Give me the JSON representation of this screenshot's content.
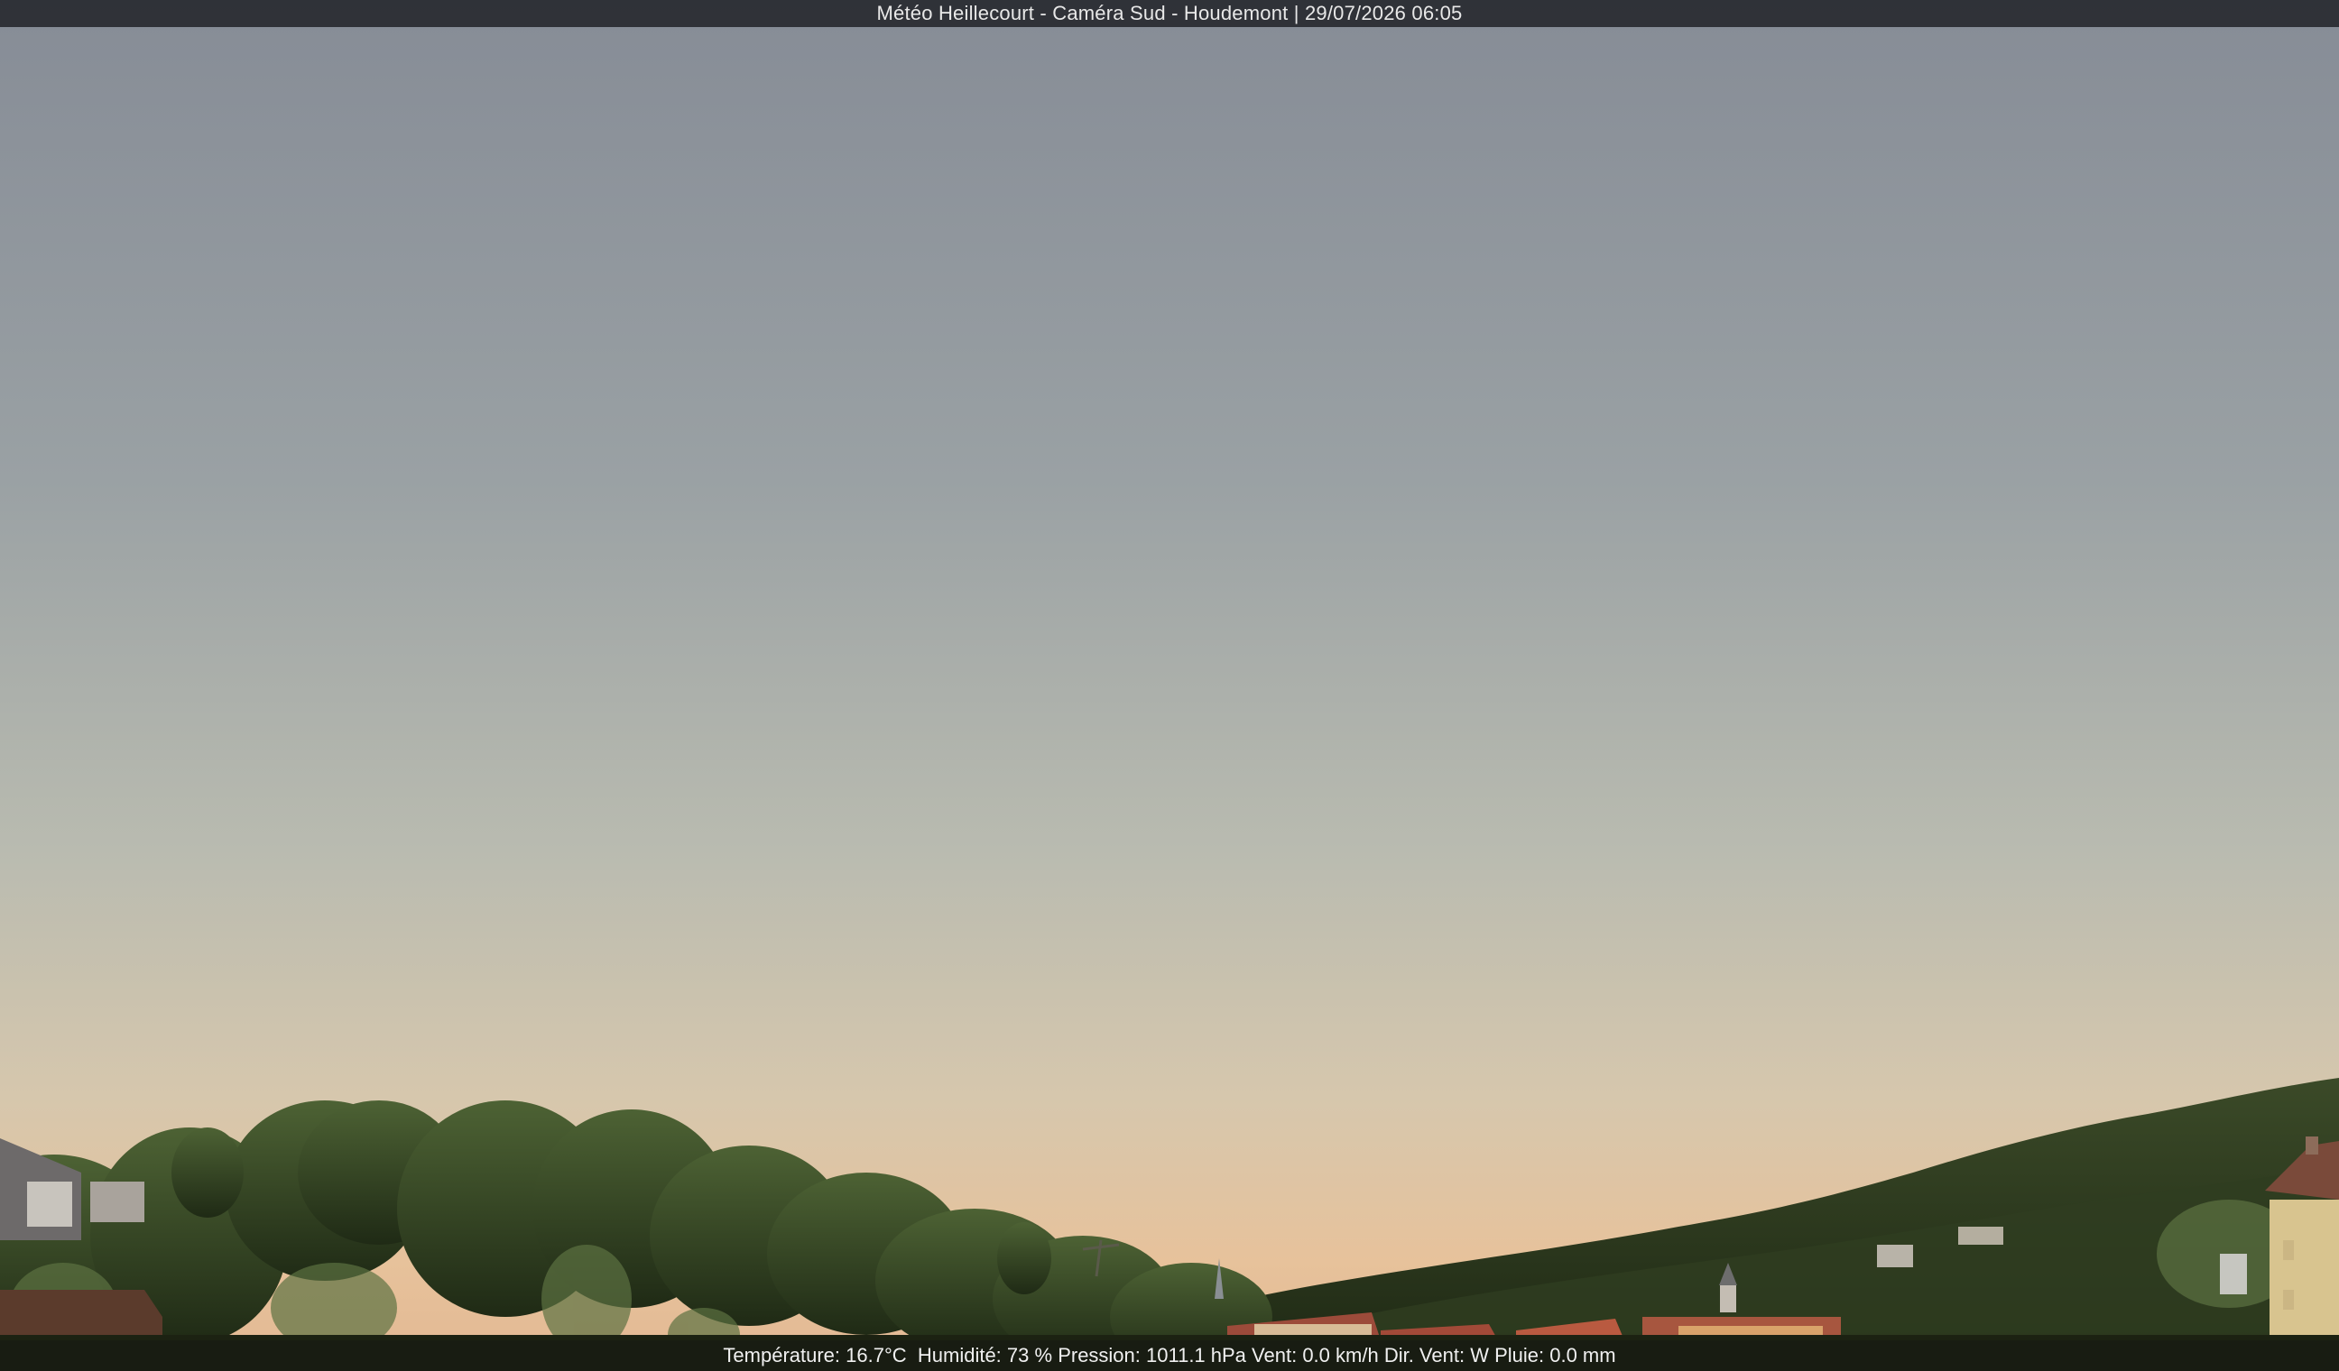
{
  "header": {
    "title": "Météo Heillecourt - Caméra Sud - Houdemont | 29/07/2026 06:05"
  },
  "footer": {
    "temperature": "Température: 16.7°C",
    "humidity": "Humidité: 73 %",
    "pressure": "Pression: 1011.1 hPa",
    "wind": "Vent: 0.0 km/h",
    "wind_dir": "Dir. Vent: W",
    "rain": "Pluie: 0.0 mm"
  },
  "colors": {
    "sky_top": "#888e97",
    "sky_mid": "#b1b5ad",
    "sky_horizon": "#e6c29c",
    "trees_dark": "#1f2a14",
    "trees_light": "#4a6030"
  }
}
